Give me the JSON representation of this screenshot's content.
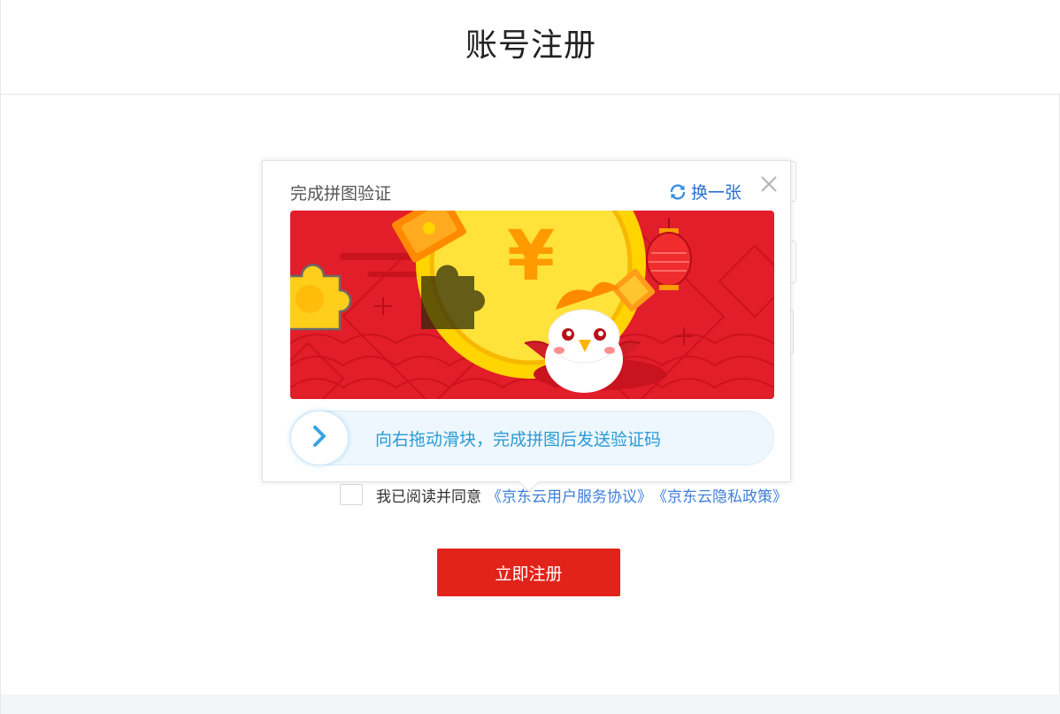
{
  "header": {
    "title": "账号注册"
  },
  "agreement": {
    "prefix": "我已阅读并同意",
    "links": [
      "《京东云用户服务协议》",
      "《京东云隐私政策》"
    ]
  },
  "register_button": {
    "label": "立即注册"
  },
  "captcha": {
    "title": "完成拼图验证",
    "refresh_label": "换一张",
    "slider_hint": "向右拖动滑块，完成拼图后发送验证码",
    "image_symbol": "¥"
  },
  "colors": {
    "brand_red": "#e2231a",
    "link_blue": "#3f7ed9",
    "slider_blue": "#2a9ad6"
  },
  "icons": [
    "refresh-icon",
    "close-icon",
    "chevron-right-icon"
  ]
}
